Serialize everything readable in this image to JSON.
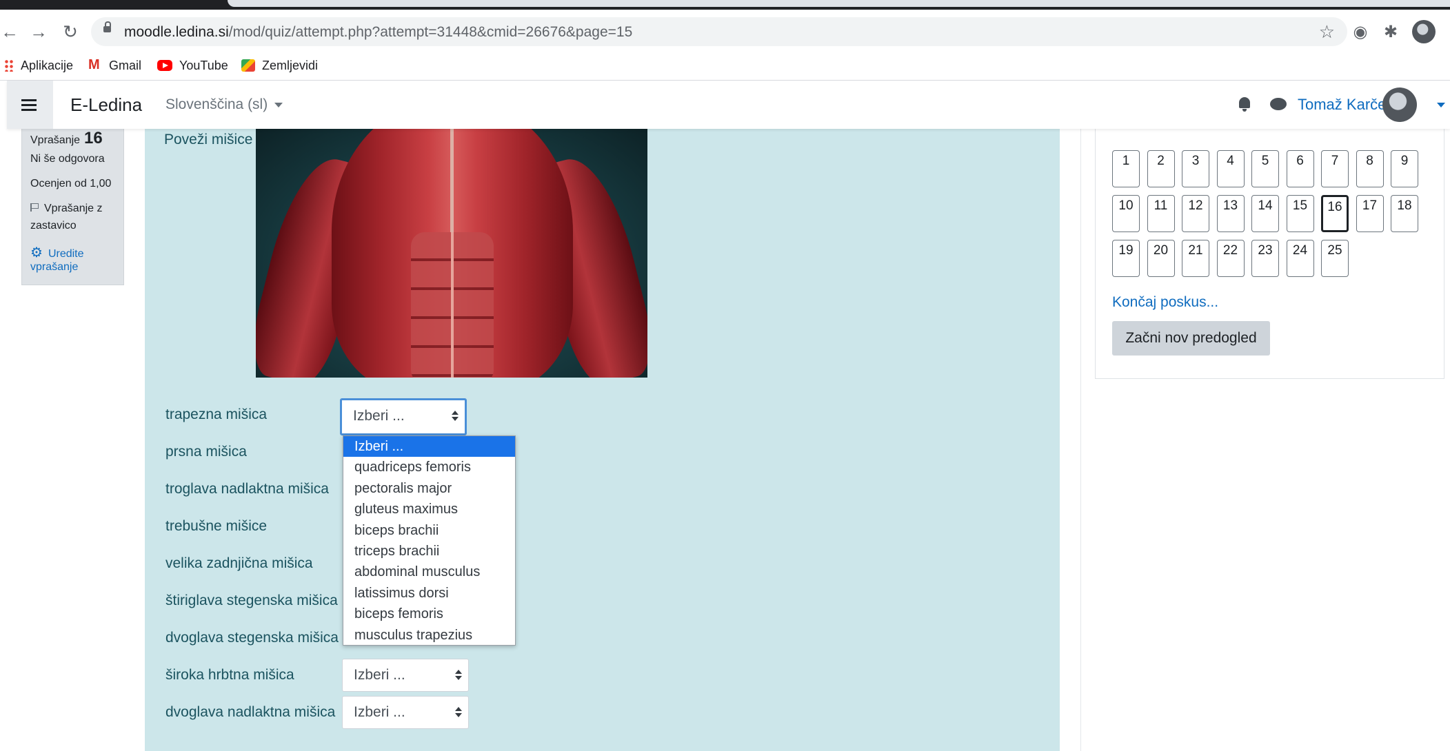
{
  "browser": {
    "url_host": "moodle.ledina.si",
    "url_rest": "/mod/quiz/attempt.php?attempt=31448&cmid=26676&page=15",
    "bookmarks": [
      {
        "label": "Aplikacije"
      },
      {
        "label": "Gmail"
      },
      {
        "label": "YouTube"
      },
      {
        "label": "Zemljevidi"
      }
    ]
  },
  "navbar": {
    "brand": "E-Ledina",
    "language": "Slovenščina (sl)",
    "user_name": "Tomaž Karče"
  },
  "question_info": {
    "question_label": "Vprašanje",
    "question_number": "16",
    "status": "Ni še odgovora",
    "grade": "Ocenjen od 1,00",
    "flag_line1": "Vprašanje z",
    "flag_line2": "zastavico",
    "edit_line1": "Uredite",
    "edit_line2": "vprašanje"
  },
  "question": {
    "text": "Poveži mišice",
    "rows": [
      {
        "label": "trapezna mišica",
        "value": "Izberi ..."
      },
      {
        "label": "prsna mišica",
        "value": "Izberi ..."
      },
      {
        "label": "troglava nadlaktna mišica",
        "value": "Izberi ..."
      },
      {
        "label": "trebušne mišice",
        "value": "Izberi ..."
      },
      {
        "label": "velika zadnjična mišica",
        "value": "Izberi ..."
      },
      {
        "label": "štiriglava stegenska mišica",
        "value": "Izberi ..."
      },
      {
        "label": "dvoglava stegenska mišica",
        "value": "Izberi ..."
      },
      {
        "label": "široka hrbtna mišica",
        "value": "Izberi ..."
      },
      {
        "label": "dvoglava nadlaktna mišica",
        "value": "Izberi ..."
      }
    ],
    "dropdown_options": [
      "Izberi ...",
      "quadriceps femoris",
      "pectoralis major",
      "gluteus maximus",
      "biceps brachii",
      "triceps brachii",
      "abdominal musculus",
      "latissimus dorsi",
      "biceps femoris",
      "musculus trapezius"
    ]
  },
  "quiz_nav": {
    "buttons": [
      "1",
      "2",
      "3",
      "4",
      "5",
      "6",
      "7",
      "8",
      "9",
      "10",
      "11",
      "12",
      "13",
      "14",
      "15",
      "16",
      "17",
      "18",
      "19",
      "20",
      "21",
      "22",
      "23",
      "24",
      "25"
    ],
    "current": "16",
    "finish_link": "Končaj poskus...",
    "new_preview": "Začni nov predogled"
  }
}
